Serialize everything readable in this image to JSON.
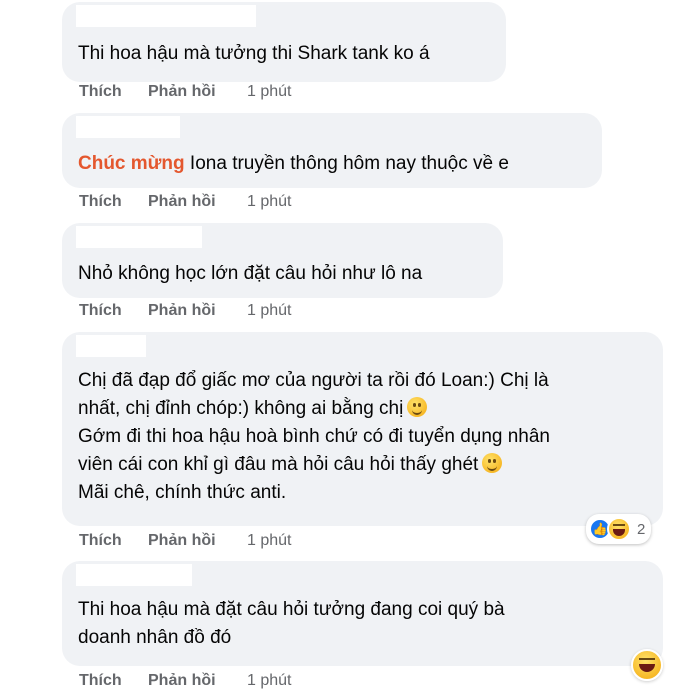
{
  "actions": {
    "like": "Thích",
    "reply": "Phản hồi"
  },
  "comments": [
    {
      "time": "1 phút",
      "lines": [
        "Thi hoa hậu mà tưởng thi Shark tank ko á"
      ]
    },
    {
      "time": "1 phút",
      "highlight": "Chúc mừng",
      "lines": [
        " Iona truyền thông hôm nay thuộc về e"
      ]
    },
    {
      "time": "1 phút",
      "lines": [
        "Nhỏ không học lớn đặt câu hỏi như lô na"
      ]
    },
    {
      "time": "1 phút",
      "lines": [
        "Chị đã đạp đổ giấc mơ của người ta rồi đó Loan:) Chị là",
        "nhất, chị đỉnh chóp:) không ai bằng chị",
        "Gớm đi thi hoa hậu hoà bình chứ có đi tuyển dụng nhân",
        "viên cái con khỉ gì đâu mà hỏi câu hỏi thấy ghét",
        "Mãi chê, chính thức anti."
      ],
      "reactions": {
        "count": "2",
        "icons": [
          "like-icon",
          "haha-icon"
        ]
      }
    },
    {
      "time": "1 phút",
      "lines": [
        "Thi hoa hậu mà đặt câu hỏi tưởng đang coi quý bà",
        "doanh nhân đồ đó"
      ],
      "reactions": {
        "icons": [
          "haha-icon"
        ]
      }
    }
  ]
}
